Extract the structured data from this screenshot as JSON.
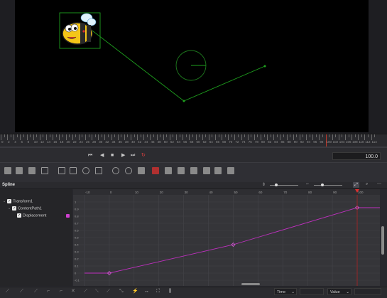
{
  "viewer": {
    "motion_path_color": "#1ea01e"
  },
  "ruler": {
    "labels": [
      "0",
      "2",
      "4",
      "6",
      "8",
      "10",
      "12",
      "14",
      "16",
      "18",
      "20",
      "22",
      "24",
      "26",
      "28",
      "30",
      "32",
      "34",
      "36",
      "38",
      "40",
      "42",
      "44",
      "46",
      "48",
      "50",
      "52",
      "54",
      "56",
      "58",
      "60",
      "62",
      "64",
      "66",
      "68",
      "70",
      "72",
      "74",
      "76",
      "78",
      "80",
      "82",
      "84",
      "86",
      "88",
      "90",
      "92",
      "94",
      "96",
      "98",
      "100",
      "102",
      "104",
      "106",
      "108",
      "110",
      "112",
      "114"
    ],
    "playhead_color": "#c0392b"
  },
  "transport": {
    "first_frame_icon": "skip-to-start-icon",
    "prev_frame_icon": "step-back-icon",
    "stop_icon": "stop-icon",
    "next_frame_icon": "step-forward-icon",
    "last_frame_icon": "skip-to-end-icon",
    "loop_icon": "loop-icon",
    "current_frame": "100.0"
  },
  "spline": {
    "title": "Spline",
    "tree": [
      {
        "label": "Transform1"
      },
      {
        "label": "ContentPath1"
      },
      {
        "label": "Displacement"
      }
    ],
    "x_ticks": [
      "-10",
      "0",
      "10",
      "20",
      "30",
      "40",
      "50",
      "60",
      "70",
      "80",
      "90",
      "100"
    ],
    "y_ticks": [
      "1",
      "0.9",
      "0.8",
      "0.7",
      "0.6",
      "0.5",
      "0.4",
      "0.3",
      "0.2",
      "0.1",
      "0",
      "-0.1"
    ],
    "curve_color": "#c030c0"
  },
  "bottom": {
    "time_label": "Time",
    "value_label": "Value"
  },
  "chart_data": {
    "type": "line",
    "x_range": [
      -12,
      115
    ],
    "y_range": [
      -0.12,
      1.05
    ],
    "series": [
      {
        "name": "Displacement",
        "x": [
          -10,
          0,
          50,
          100,
          115
        ],
        "y": [
          0,
          0,
          0.4,
          0.92,
          0.92
        ]
      }
    ],
    "keyframes": [
      {
        "x": 0,
        "y": 0
      },
      {
        "x": 50,
        "y": 0.4
      },
      {
        "x": 100,
        "y": 0.92
      }
    ],
    "playhead_x": 100
  }
}
